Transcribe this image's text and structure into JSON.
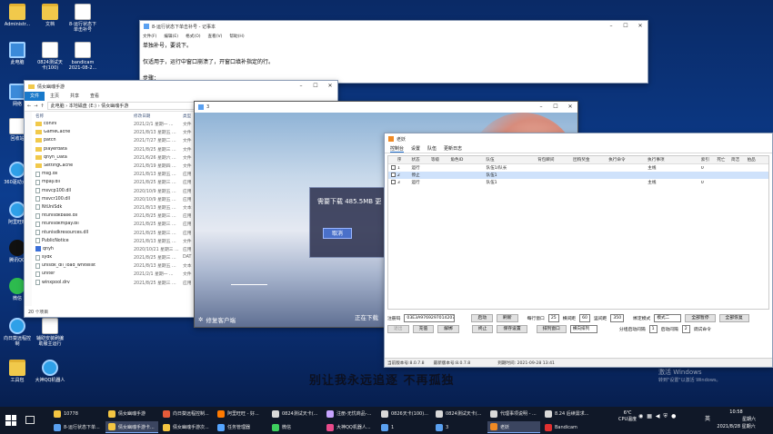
{
  "desktop": {
    "icons": [
      {
        "label": "Administr...",
        "glyph": "user-folder-icon"
      },
      {
        "label": "文档",
        "glyph": "folder-icon"
      },
      {
        "label": "8-运行状态下\n单击补号",
        "glyph": "text-file-icon"
      },
      {
        "label": "此电脑",
        "glyph": "computer-icon"
      },
      {
        "label": "0824测试天\n卡(100)",
        "glyph": "text-file-icon"
      },
      {
        "label": "bandicam\n2021-08-2...",
        "glyph": "text-file-icon"
      },
      {
        "label": "网络",
        "glyph": "network-icon"
      },
      {
        "label": "回收站",
        "glyph": "recycle-bin-icon"
      },
      {
        "label": "360驱动大师",
        "glyph": "app-icon"
      },
      {
        "label": "阿里旺旺",
        "glyph": "app-icon"
      },
      {
        "label": "腾讯QQ",
        "glyph": "qq-icon"
      },
      {
        "label": "微信",
        "glyph": "wechat-icon"
      },
      {
        "label": "向日葵远程控制",
        "glyph": "app-icon"
      },
      {
        "label": "辅助安装刷编\n助服主运行",
        "glyph": "text-file-icon"
      },
      {
        "label": "工具包",
        "glyph": "folder-icon"
      },
      {
        "label": "大神QQ机器人",
        "glyph": "app-icon"
      }
    ],
    "slogan": "别让我永远追逐  不再孤独",
    "watermark": {
      "line1": "激活 Windows",
      "line2": "转到\"设置\"以激活 Windows。"
    }
  },
  "notepad": {
    "title": "8-运行状态下单击补号 - 记事本",
    "menu": [
      "文件(F)",
      "编辑(E)",
      "格式(O)",
      "查看(V)",
      "帮助(H)"
    ],
    "lines": [
      "单独补号，要说下。",
      "",
      "仅适用于，运行中窗口崩溃了，开窗口填补指定的行。",
      "",
      "步骤：",
      "先开窗口扫码"
    ]
  },
  "explorer": {
    "title": "倩女幽魂手游",
    "ribbon_tabs": [
      "文件",
      "主页",
      "共享",
      "查看"
    ],
    "breadcrumb": "此电脑  ›  本地磁盘 (E:)  ›  倩女幽魂手游",
    "columns": [
      "名称",
      "修改日期",
      "类型"
    ],
    "files": [
      {
        "name": "conini",
        "date": "2021/2/1 星期一 ...",
        "type": "文件",
        "kind": "folder"
      },
      {
        "name": "GameCache",
        "date": "2021/8/13 星期五 ...",
        "type": "文件",
        "kind": "folder"
      },
      {
        "name": "patch",
        "date": "2021/7/27 星期二 ...",
        "type": "文件",
        "kind": "folder"
      },
      {
        "name": "playerdata",
        "date": "2021/8/25 星期三 ...",
        "type": "文件",
        "kind": "folder"
      },
      {
        "name": "qnyh_Data",
        "date": "2021/6/26 星期六 ...",
        "type": "文件",
        "kind": "folder"
      },
      {
        "name": "SettingCache",
        "date": "2021/8/19 星期四 ...",
        "type": "文件",
        "kind": "folder"
      },
      {
        "name": "msg.dll",
        "date": "2021/8/13 星期五 ...",
        "type": "应用",
        "kind": "file"
      },
      {
        "name": "mpay.dll",
        "date": "2021/8/25 星期三 ...",
        "type": "应用",
        "kind": "file"
      },
      {
        "name": "msvcp100.dll",
        "date": "2020/10/9 星期五 ...",
        "type": "应用",
        "kind": "file"
      },
      {
        "name": "msvcr100.dll",
        "date": "2020/10/9 星期五 ...",
        "type": "应用",
        "kind": "file"
      },
      {
        "name": "NtUniSdk",
        "date": "2021/8/13 星期五 ...",
        "type": "文本",
        "kind": "file"
      },
      {
        "name": "ntunisdkbase.dll",
        "date": "2021/8/25 星期三 ...",
        "type": "应用",
        "kind": "file"
      },
      {
        "name": "ntunisdkmpay.dll",
        "date": "2021/8/25 星期三 ...",
        "type": "应用",
        "kind": "file"
      },
      {
        "name": "ntunisdkresources.dll",
        "date": "2021/8/25 星期三 ...",
        "type": "应用",
        "kind": "file"
      },
      {
        "name": "PublicNotice",
        "date": "2021/8/13 星期五 ...",
        "type": "文件",
        "kind": "file"
      },
      {
        "name": "qnyh",
        "date": "2020/10/21 星期三 ...",
        "type": "应用",
        "kind": "app"
      },
      {
        "name": "sydk",
        "date": "2021/8/25 星期三 ...",
        "type": "DAT",
        "kind": "file"
      },
      {
        "name": "unisdk_dll_load_whitelist",
        "date": "2021/8/13 星期五 ...",
        "type": "文本",
        "kind": "file"
      },
      {
        "name": "uniter",
        "date": "2021/2/1 星期一 ...",
        "type": "文件",
        "kind": "file"
      },
      {
        "name": "winxpool.drv",
        "date": "2021/8/25 星期三 ...",
        "type": "应用",
        "kind": "file"
      }
    ],
    "item_count": "20 个项目"
  },
  "launcher": {
    "title": "3",
    "download_text": "需要下载 485.5MB 更",
    "cancel_label": "取消",
    "repair_label": "修复客户端",
    "bottom_text": "正在下载"
  },
  "tool": {
    "title": "老妖",
    "tabs": [
      "控制台",
      "设置",
      "队伍",
      "更新日志"
    ],
    "columns": [
      "序",
      "状态",
      "等级",
      "角色ID",
      "队伍",
      "背包瞬间",
      "团购奖金",
      "执行命令",
      "执行事项",
      "索引",
      "死亡",
      "简洁",
      "拍品"
    ],
    "rows": [
      {
        "idx": "1",
        "status": "运行",
        "team": "队伍1/队长",
        "task": "主线",
        "index": "0",
        "selected": false
      },
      {
        "idx": "2",
        "status": "停止",
        "team": "队伍1",
        "task": "",
        "index": "",
        "selected": true
      },
      {
        "idx": "3",
        "status": "运行",
        "team": "队伍1",
        "task": "主线",
        "index": "0",
        "selected": false
      }
    ],
    "controls": {
      "reg_label": "注册码",
      "reg_value": "03E3A9769297014207414",
      "start_label": "启动",
      "refresh_label": "刷新",
      "per_row_label": "每行窗口",
      "per_row_value": "25",
      "interval_label": "横间距",
      "interval_value": "60",
      "vertical_label": "竖间距",
      "vertical_value": "350",
      "mode_label": "绑定模式",
      "mode_value": "模式二",
      "pause_all_label": "全部暂停",
      "restore_all_label": "全部恢复",
      "tab_deposit": "退出",
      "recharge_label": "充值",
      "unbind_label": "解绑",
      "stop_label": "终止",
      "save_label": "保存设置",
      "arrange_label": "排列窗口",
      "arrange_mode": "横向排列",
      "split_label": "分组启动间隔",
      "split_value": "1",
      "start_interval_label": "启动间隔",
      "start_interval_value": "2",
      "debug_label": "调试命令"
    },
    "status": {
      "version_now": "当前版本号:8.0.7.8",
      "version_latest": "最新版本号:8.0.7.8",
      "expire_label": "到期时间: 2021-09-28 13:41"
    }
  },
  "taskbar": {
    "top_row": [
      {
        "label": "10778",
        "color": "#f4c542"
      },
      {
        "label": "倩女幽魂手游",
        "color": "#f4c542"
      },
      {
        "label": "向日葵远程控制...",
        "color": "#e65b3a"
      },
      {
        "label": "阿里旺旺 - 好...",
        "color": "#ff7a00"
      },
      {
        "label": "0824测试天卡(...",
        "color": "#d9d9d9"
      },
      {
        "label": "注册-无忧商品-...",
        "color": "#c7a4ff"
      },
      {
        "label": "0826天卡(100)...",
        "color": "#d9d9d9"
      },
      {
        "label": "0824测试天卡(...",
        "color": "#d9d9d9"
      },
      {
        "label": "代理事项说明 - ...",
        "color": "#d9d9d9"
      },
      {
        "label": "8.24 后续需求...",
        "color": "#d9d9d9"
      }
    ],
    "bottom_row": [
      {
        "label": "8-运行状态下单...",
        "color": "#5aa0f0",
        "active": false
      },
      {
        "label": "倩女幽魂手游卡...",
        "color": "#f4c542",
        "active": true
      },
      {
        "label": "倩女幽魂手游次...",
        "color": "#f4c542",
        "active": false
      },
      {
        "label": "任务管理器",
        "color": "#55a5ff",
        "active": false
      },
      {
        "label": "微信",
        "color": "#3ecf5e",
        "active": false
      },
      {
        "label": "大神QQ机器人...",
        "color": "#e84a8a",
        "active": false
      },
      {
        "label": "1",
        "color": "#5aa0f0",
        "active": false
      },
      {
        "label": "3",
        "color": "#5aa0f0",
        "active": false
      },
      {
        "label": "老妖",
        "color": "#f08a24",
        "active": true
      },
      {
        "label": "Bandicam",
        "color": "#e03030",
        "active": false
      }
    ],
    "weather_temp": "6℃",
    "cpu_label": "CPU温度",
    "ime_label": "英",
    "time": "10:58",
    "weekday": "星期六",
    "date": "2021/8/28 星期六"
  }
}
